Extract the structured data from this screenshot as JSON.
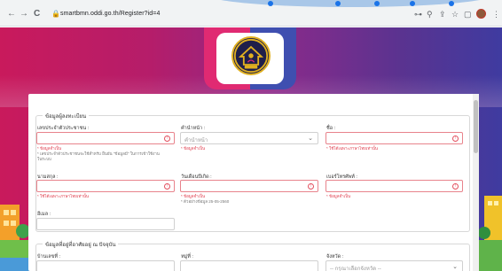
{
  "browser": {
    "url": "smartbmn.oddi.go.th/Register?id=4",
    "icons": [
      "back-icon",
      "forward-icon",
      "reload-icon",
      "lock-icon",
      "key-icon",
      "zoom-icon",
      "share-icon",
      "star-icon",
      "sidepanel-icon",
      "profile-icon",
      "menu-icon"
    ],
    "glyphs": {
      "back": "←",
      "forward": "→",
      "reload": "C",
      "lock": "🔒",
      "key": "⊶",
      "zoom": "⚲",
      "share": "⇪",
      "star": "☆",
      "panel": "▢",
      "menu": "⋮"
    }
  },
  "section1": {
    "title": "ข้อมูลผู้ลงทะเบียน",
    "id_card": {
      "label": "เลขประจำตัวประชาชน :",
      "error": "* ข้อมูลจำเป็น",
      "hint1": "* เลขประจำตัวประชาชนจะใช้สำหรับ ยืนยัน \"ข้อมูลมี\" ในการเข้าใช้งาน",
      "hint2": "ในระบบ"
    },
    "prefix": {
      "label": "คำนำหน้า :",
      "placeholder": "คำนำหน้า",
      "error": "* ข้อมูลจำเป็น"
    },
    "first_name": {
      "label": "ชื่อ :",
      "error": "* ใช้ได้เฉพาะภาษาไทยเท่านั้น"
    },
    "last_name": {
      "label": "นามสกุล :",
      "error": "* ใช้ได้เฉพาะภาษาไทยเท่านั้น"
    },
    "birthdate": {
      "label": "วันเดือนปีเกิด :",
      "error": "* ข้อมูลจำเป็น",
      "hint": "* ตัวอย่างข้อมูล 25-05-2560"
    },
    "phone": {
      "label": "เบอร์โทรศัพท์ :",
      "error": "* ข้อมูลจำเป็น"
    },
    "email": {
      "label": "อีเมล :"
    }
  },
  "section2": {
    "title": "ข้อมูลที่อยู่ที่อาศัยอยู่ ณ ปัจจุบัน",
    "house_no": {
      "label": "บ้านเลขที่ :"
    },
    "moo": {
      "label": "หมู่ที่ :"
    },
    "province": {
      "label": "จังหวัด :",
      "placeholder": "-- กรุณาเลือกจังหวัด --"
    }
  },
  "colors": {
    "brand_pink": "#e02a72",
    "brand_blue": "#3f4fb0",
    "error_red": "#e04050"
  }
}
